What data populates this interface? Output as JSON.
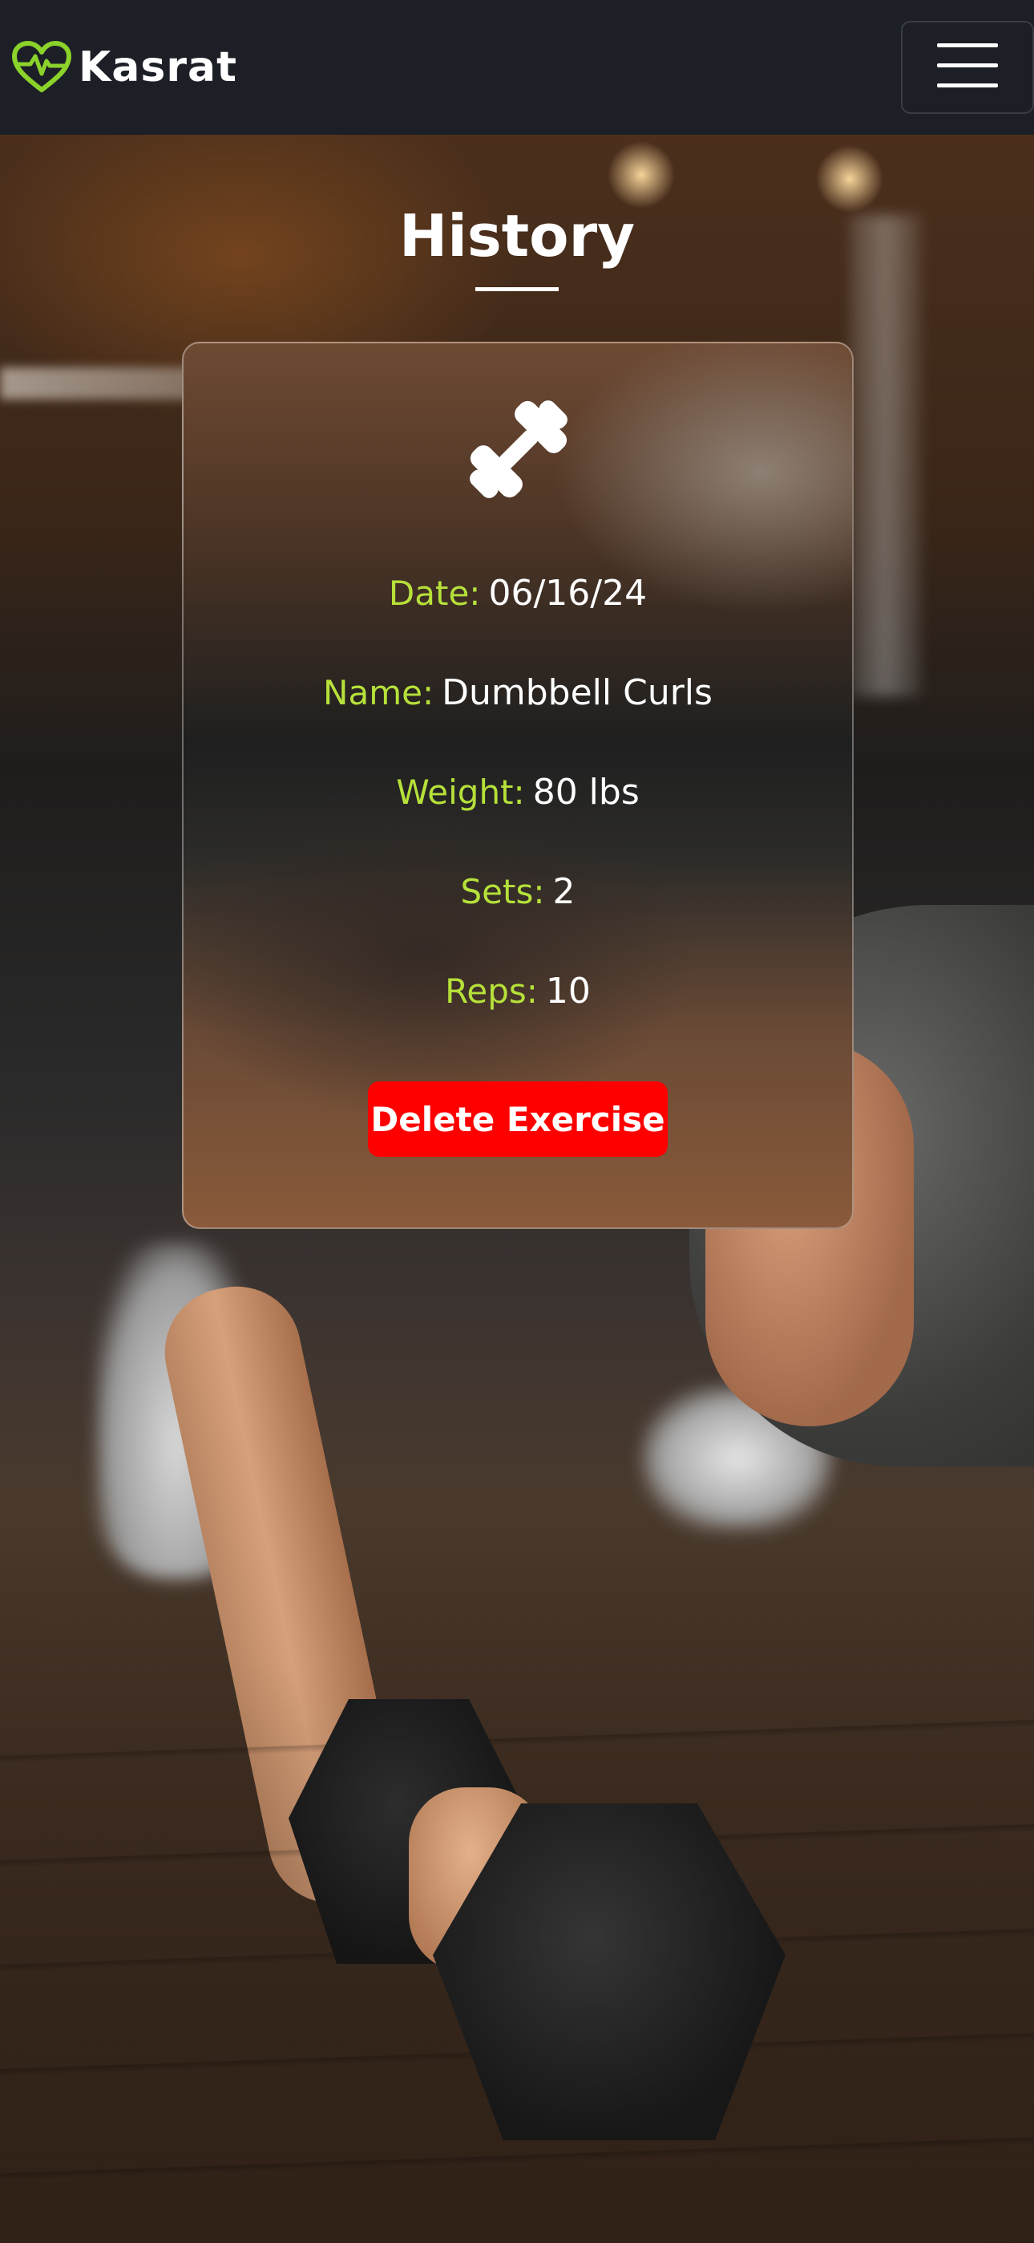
{
  "navbar": {
    "brand_name": "Kasrat",
    "brand_icon": "heart-pulse-icon",
    "brand_color": "#8bd32a",
    "menu_icon": "hamburger-menu-icon"
  },
  "page": {
    "title": "History"
  },
  "history_card": {
    "icon": "dumbbell-icon",
    "fields": {
      "date_label": "Date:",
      "date_value": "06/16/24",
      "name_label": "Name:",
      "name_value": "Dumbbell Curls",
      "weight_label": "Weight:",
      "weight_value": "80 lbs",
      "sets_label": "Sets:",
      "sets_value": "2",
      "reps_label": "Reps:",
      "reps_value": "10"
    },
    "delete_button_label": "Delete Exercise",
    "label_color": "#b6e13a",
    "delete_button_color": "#ff0000"
  }
}
